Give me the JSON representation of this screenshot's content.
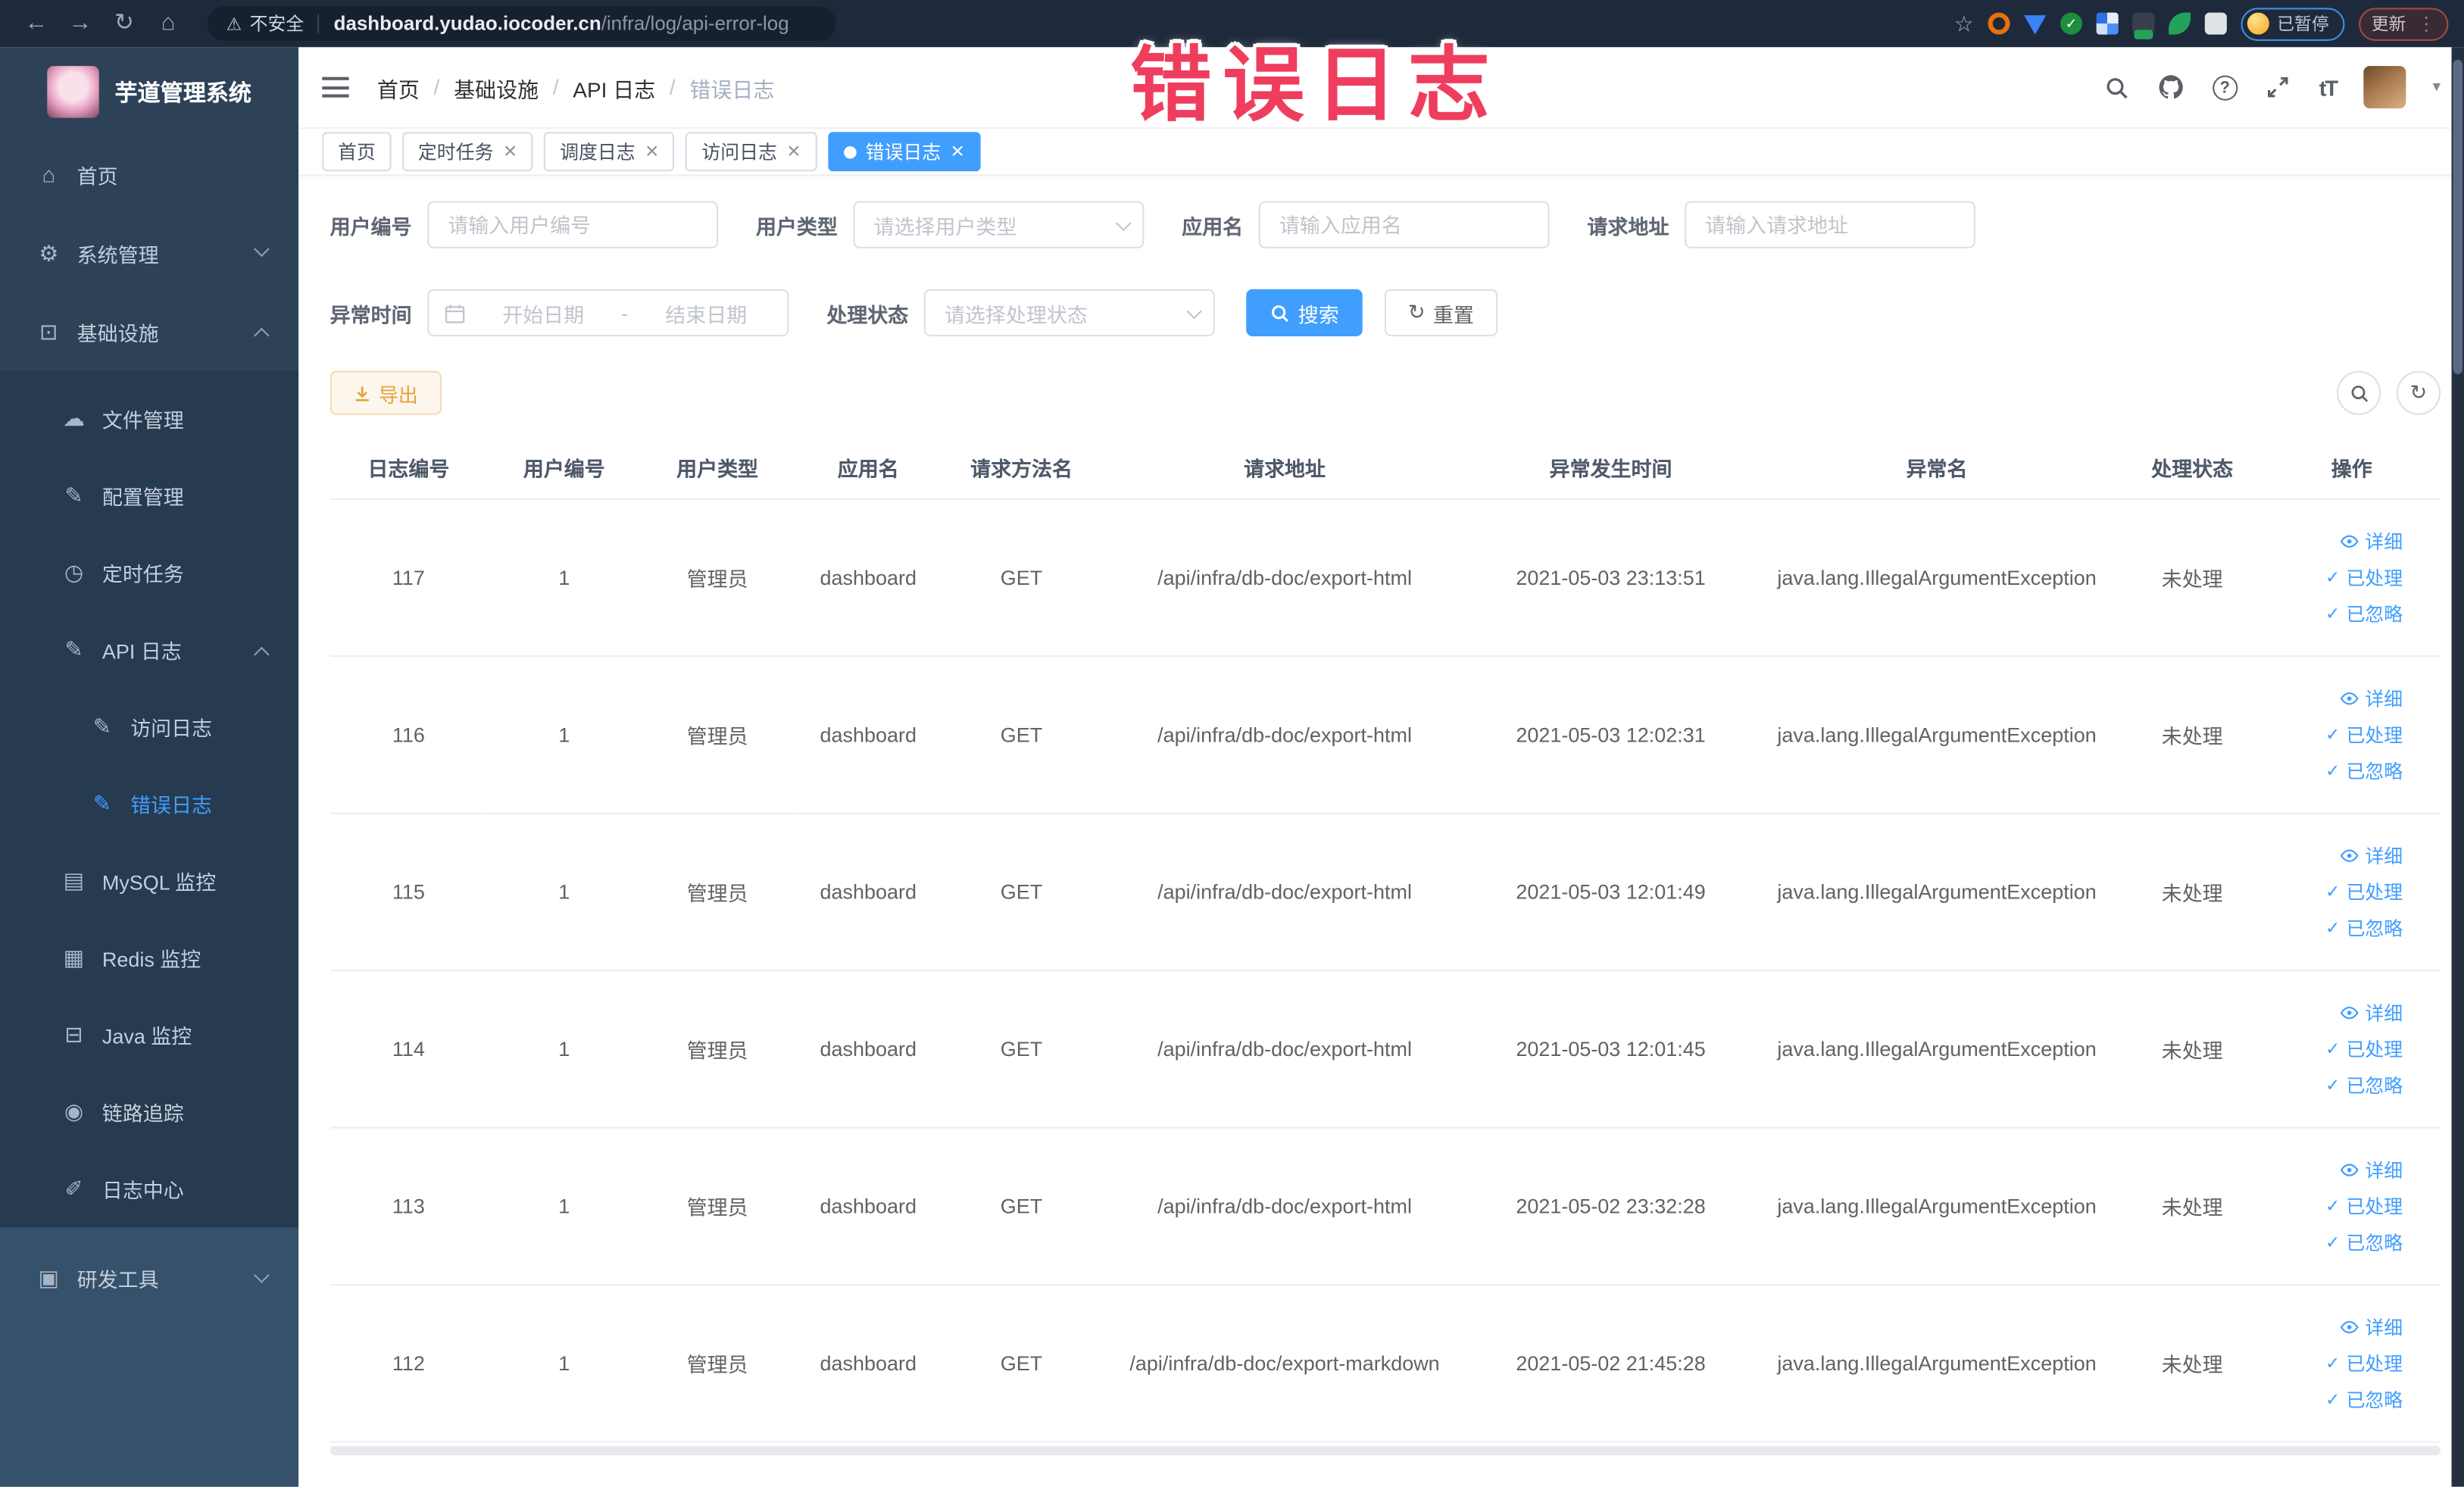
{
  "browser": {
    "security_label": "不安全",
    "url_domain": "dashboard.yudao.iocoder.cn",
    "url_path": "/infra/log/api-error-log",
    "paused_badge": "已暂停",
    "update_badge": "更新"
  },
  "annotation": {
    "text": "错误日志",
    "color": "#ef3d5e"
  },
  "sidebar": {
    "title": "芋道管理系统",
    "menu": [
      {
        "label": "首页"
      },
      {
        "label": "系统管理"
      },
      {
        "label": "基础设施"
      },
      {
        "label": "文件管理"
      },
      {
        "label": "配置管理"
      },
      {
        "label": "定时任务"
      },
      {
        "label": "API 日志"
      },
      {
        "label": "访问日志"
      },
      {
        "label": "错误日志",
        "active": true
      },
      {
        "label": "MySQL 监控"
      },
      {
        "label": "Redis 监控"
      },
      {
        "label": "Java 监控"
      },
      {
        "label": "链路追踪"
      },
      {
        "label": "日志中心"
      },
      {
        "label": "研发工具"
      }
    ]
  },
  "header": {
    "breadcrumb": [
      "首页",
      "基础设施",
      "API 日志",
      "错误日志"
    ]
  },
  "tabs": [
    {
      "label": "首页",
      "closable": false,
      "active": false
    },
    {
      "label": "定时任务",
      "closable": true,
      "active": false
    },
    {
      "label": "调度日志",
      "closable": true,
      "active": false
    },
    {
      "label": "访问日志",
      "closable": true,
      "active": false
    },
    {
      "label": "错误日志",
      "closable": true,
      "active": true
    }
  ],
  "filters": {
    "user_id": {
      "label": "用户编号",
      "placeholder": "请输入用户编号"
    },
    "user_type": {
      "label": "用户类型",
      "placeholder": "请选择用户类型"
    },
    "app_name": {
      "label": "应用名",
      "placeholder": "请输入应用名"
    },
    "request_url": {
      "label": "请求地址",
      "placeholder": "请输入请求地址"
    },
    "exception_time": {
      "label": "异常时间",
      "start_placeholder": "开始日期",
      "separator": "-",
      "end_placeholder": "结束日期"
    },
    "process_status": {
      "label": "处理状态",
      "placeholder": "请选择处理状态"
    },
    "search_label": "搜索",
    "reset_label": "重置"
  },
  "toolbar": {
    "export_label": "导出"
  },
  "table": {
    "columns": [
      "日志编号",
      "用户编号",
      "用户类型",
      "应用名",
      "请求方法名",
      "请求地址",
      "异常发生时间",
      "异常名",
      "处理状态",
      "操作"
    ],
    "actions": {
      "detail": "详细",
      "processed": "已处理",
      "ignored": "已忽略"
    },
    "rows": [
      {
        "id": "117",
        "user_id": "1",
        "user_type": "管理员",
        "app_name": "dashboard",
        "method": "GET",
        "url": "/api/infra/db-doc/export-html",
        "time": "2021-05-03 23:13:51",
        "exception": "java.lang.IllegalArgumentException",
        "status": "未处理"
      },
      {
        "id": "116",
        "user_id": "1",
        "user_type": "管理员",
        "app_name": "dashboard",
        "method": "GET",
        "url": "/api/infra/db-doc/export-html",
        "time": "2021-05-03 12:02:31",
        "exception": "java.lang.IllegalArgumentException",
        "status": "未处理"
      },
      {
        "id": "115",
        "user_id": "1",
        "user_type": "管理员",
        "app_name": "dashboard",
        "method": "GET",
        "url": "/api/infra/db-doc/export-html",
        "time": "2021-05-03 12:01:49",
        "exception": "java.lang.IllegalArgumentException",
        "status": "未处理"
      },
      {
        "id": "114",
        "user_id": "1",
        "user_type": "管理员",
        "app_name": "dashboard",
        "method": "GET",
        "url": "/api/infra/db-doc/export-html",
        "time": "2021-05-03 12:01:45",
        "exception": "java.lang.IllegalArgumentException",
        "status": "未处理"
      },
      {
        "id": "113",
        "user_id": "1",
        "user_type": "管理员",
        "app_name": "dashboard",
        "method": "GET",
        "url": "/api/infra/db-doc/export-html",
        "time": "2021-05-02 23:32:28",
        "exception": "java.lang.IllegalArgumentException",
        "status": "未处理"
      },
      {
        "id": "112",
        "user_id": "1",
        "user_type": "管理员",
        "app_name": "dashboard",
        "method": "GET",
        "url": "/api/infra/db-doc/export-markdown",
        "time": "2021-05-02 21:45:28",
        "exception": "java.lang.IllegalArgumentException",
        "status": "未处理"
      }
    ]
  },
  "colors": {
    "accent": "#409eff",
    "warning": "#e6a23c",
    "sidebar_bg": "#2d4257",
    "annotation_red": "#ef3d5e"
  }
}
